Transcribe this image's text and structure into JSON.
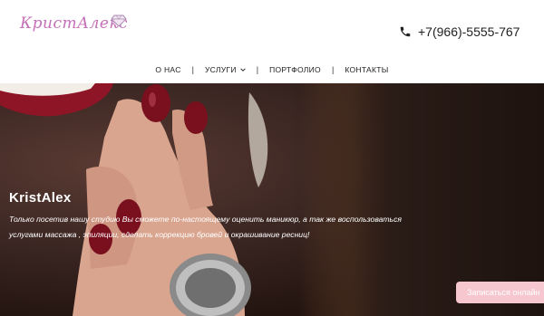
{
  "header": {
    "logo_text": "КристАлекс",
    "phone": "+7(966)-5555-767"
  },
  "nav": {
    "items": [
      {
        "label": "О НАС"
      },
      {
        "label": "УСЛУГИ"
      },
      {
        "label": "ПОРТФОЛИО"
      },
      {
        "label": "КОНТАКТЫ"
      }
    ],
    "separator": "|"
  },
  "hero": {
    "title": "KristAlex",
    "text": "Только посетив нашу студию Вы сможете по-настоящему оценить маникюр, а так же воспользоваться услугами массажа , эпиляции, сделать коррекцию бровей и окрашивание ресниц!"
  },
  "cta": {
    "label": "Записаться онлайн"
  },
  "colors": {
    "logo": "#c56fb8",
    "cta_bg": "#f6c7cf",
    "nail": "#7a0f1e"
  }
}
